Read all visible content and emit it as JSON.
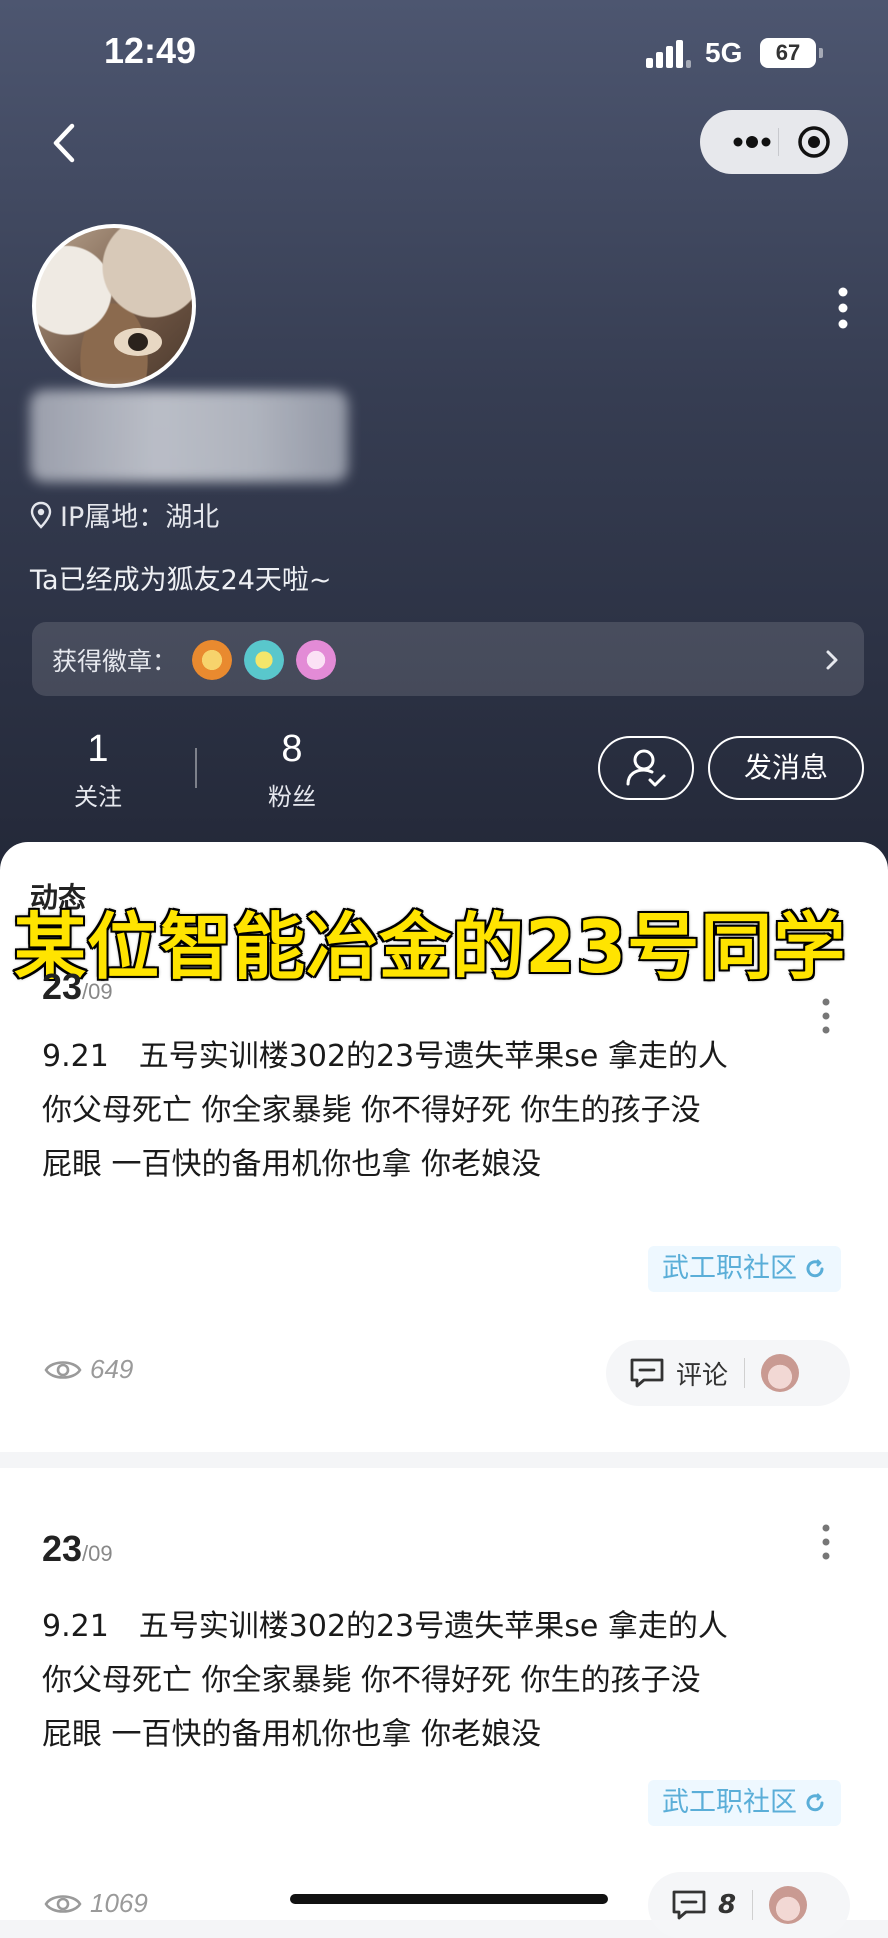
{
  "status_bar": {
    "time": "12:49",
    "network": "5G",
    "battery": "67"
  },
  "nav": {
    "back_icon": "chevron-left-icon",
    "more_icon": "more-horizontal-icon",
    "close_icon": "target-icon"
  },
  "profile": {
    "ip_location": "IP属地：湖北",
    "joined_text": "Ta已经成为狐友24天啦~",
    "badges_label": "获得徽章：",
    "badges": [
      {
        "icon": "badge-orange-icon",
        "color": "#f0a040"
      },
      {
        "icon": "badge-teal-icon",
        "color": "#4cc2c8"
      },
      {
        "icon": "badge-pink-icon",
        "color": "#e48ad8"
      }
    ],
    "stats": [
      {
        "value": "1",
        "label": "关注"
      },
      {
        "value": "8",
        "label": "粉丝"
      }
    ],
    "follow_icon": "user-check-icon",
    "message_label": "发消息"
  },
  "feed": {
    "title": "动态",
    "overlay_caption": "某位智能冶金的23号同学",
    "posts": [
      {
        "day": "23",
        "month": "/09",
        "lines": [
          "9.21　五号实训楼302的23号遗失苹果se 拿走的人",
          "你父母死亡 你全家暴毙 你不得好死 你生的孩子没",
          "屁眼 一百快的备用机你也拿 你老娘没"
        ],
        "tag": "武工职社区",
        "views": "649",
        "comment_label": "评论"
      },
      {
        "day": "23",
        "month": "/09",
        "lines": [
          "9.21　五号实训楼302的23号遗失苹果se 拿走的人",
          "你父母死亡 你全家暴毙 你不得好死 你生的孩子没",
          "屁眼 一百快的备用机你也拿 你老娘没"
        ],
        "tag": "武工职社区",
        "views": "1069",
        "comment_label": "8"
      }
    ]
  }
}
